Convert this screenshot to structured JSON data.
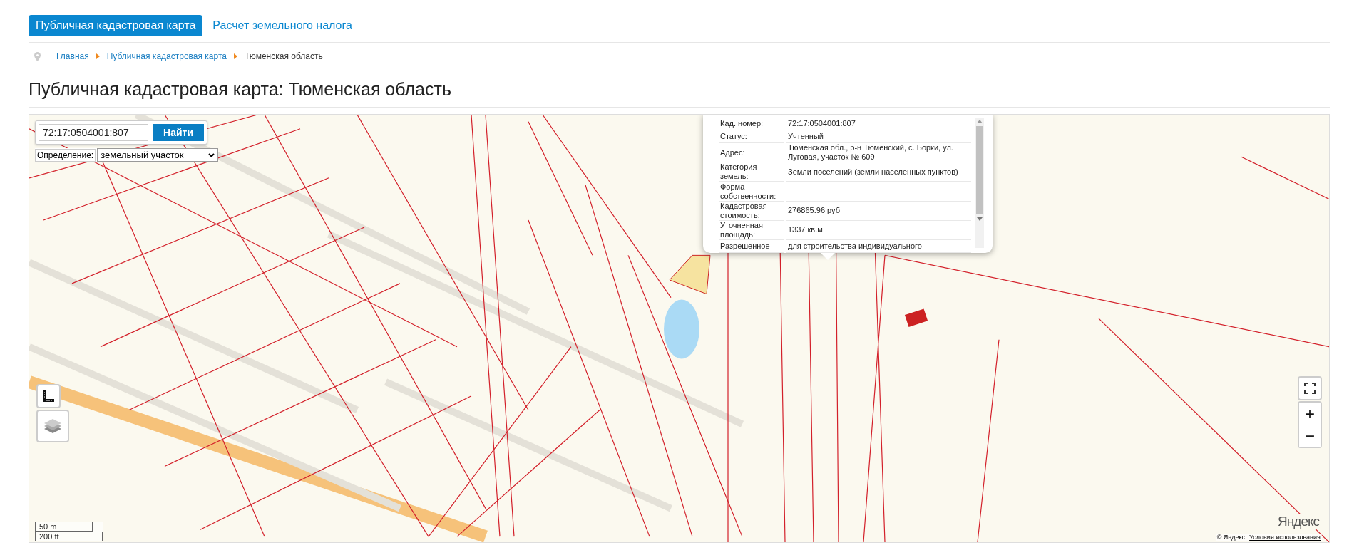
{
  "nav_tabs": [
    {
      "label": "Публичная кадастровая карта",
      "selected": true
    },
    {
      "label": "Расчет земельного налога",
      "selected": false
    }
  ],
  "breadcrumbs": [
    {
      "label": "Главная",
      "kind": "link"
    },
    {
      "label": "Публичная кадастровая карта",
      "kind": "link"
    },
    {
      "label": "Тюменская область",
      "kind": "current"
    }
  ],
  "page_title": "Публичная кадастровая карта: Тюменская область",
  "map": {
    "search": {
      "value": "72:17:0504001:807",
      "button": "Найти"
    },
    "definition": {
      "label": "Определение:",
      "value": "земельный участок"
    },
    "popup": {
      "rows": [
        {
          "label": "Кад. номер:",
          "value": "72:17:0504001:807"
        },
        {
          "label": "Статус:",
          "value": "Учтенный"
        },
        {
          "label": "Адрес:",
          "value": "Тюменская обл., р-н Тюменский, с. Борки, ул. Луговая, участок № 609"
        },
        {
          "label": "Категория земель:",
          "value": "Земли поселений (земли населенных пунктов)"
        },
        {
          "label": "Форма собственности:",
          "value": "-"
        },
        {
          "label": "Кадастровая стоимость:",
          "value": "276865.96 руб"
        },
        {
          "label": "Уточненная площадь:",
          "value": "1337 кв.м"
        },
        {
          "label": "Разрешенное",
          "value": "для строительства индивидуального"
        }
      ]
    },
    "scale": {
      "metric": "50 m",
      "imperial": "200 ft"
    },
    "zoom_buttons": [
      "+",
      "−"
    ],
    "logo": "Яндекс",
    "copyright": "© Яндекс",
    "terms_link": "Условия использования"
  }
}
